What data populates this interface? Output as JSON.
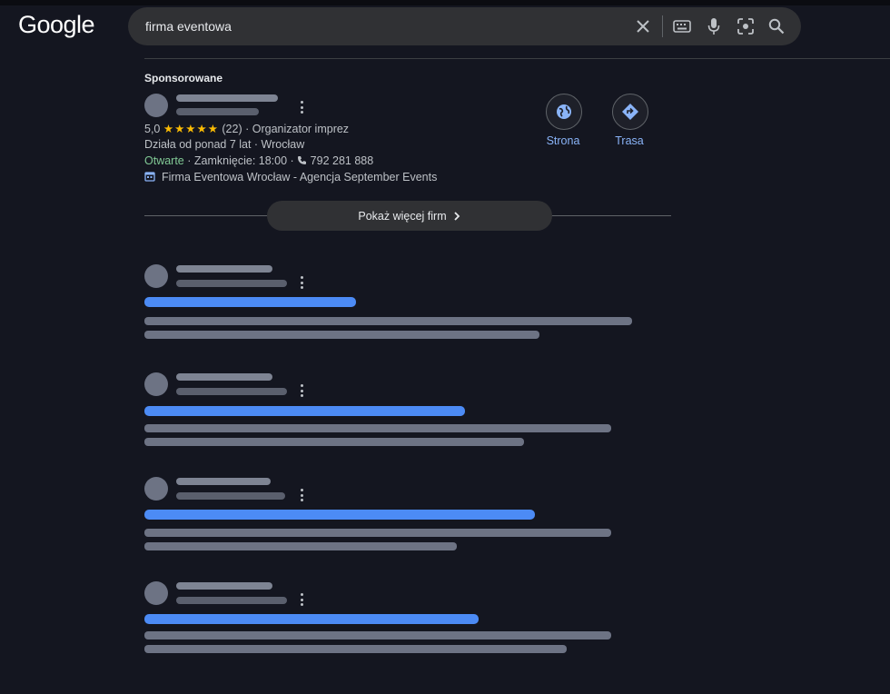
{
  "header": {
    "logo_text": "Google",
    "search": {
      "query": "firma eventowa"
    },
    "icons": [
      "clear-icon",
      "keyboard-icon",
      "microphone-icon",
      "lens-icon",
      "search-icon"
    ]
  },
  "ad": {
    "sponsored_label": "Sponsorowane",
    "rating": "5,0",
    "stars": "★★★★★",
    "review_count": "(22)",
    "category": "Organizator imprez",
    "sep": "·",
    "since_location": "Działa od ponad 7 lat · Wrocław",
    "status_open": "Otwarte",
    "closing": "Zamknięcie: 18:00",
    "phone": "792 281 888",
    "site_name": "Firma Eventowa Wrocław - Agencja September Events",
    "website_label": "Strona",
    "directions_label": "Trasa"
  },
  "more_businesses_label": "Pokaż więcej firm",
  "colors": {
    "background": "#141620",
    "search_box": "#303134",
    "placeholder_bar": "#6d7384",
    "link_bar": "#4c8bf5",
    "star": "#fbbc04",
    "open_status": "#81c995",
    "action_label": "#8ab4f8"
  }
}
